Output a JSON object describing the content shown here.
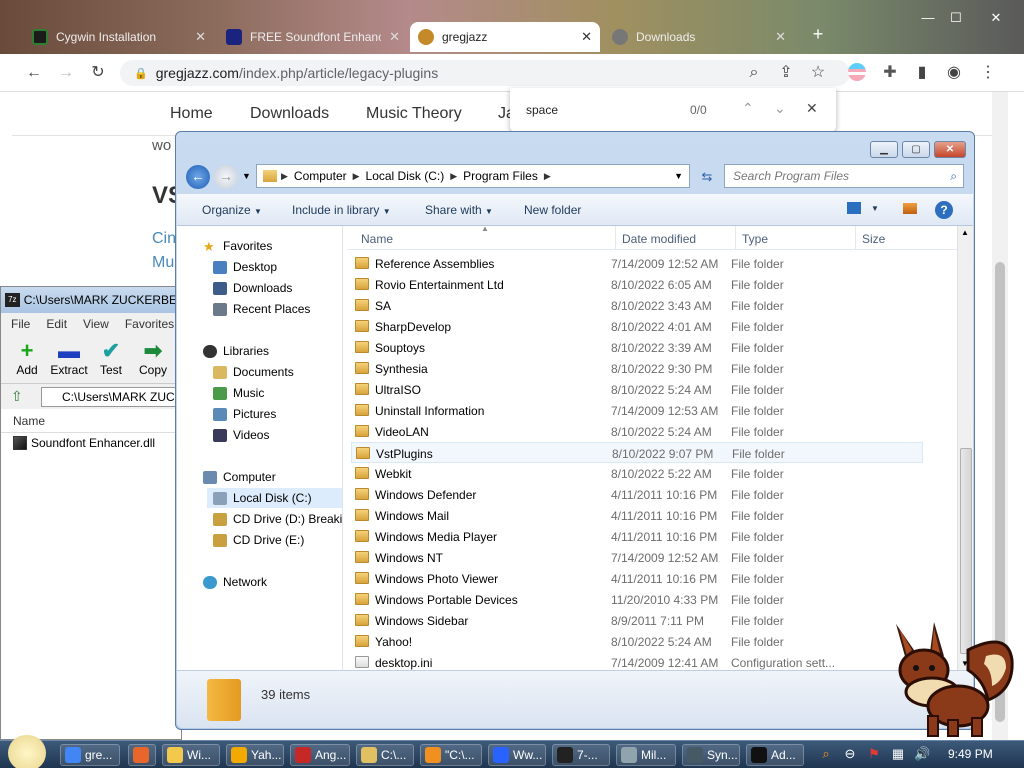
{
  "browser": {
    "tabs": [
      {
        "label": "Cygwin Installation",
        "color": "#2e7d32"
      },
      {
        "label": "FREE Soundfont Enhancer",
        "color": "#1a237e"
      },
      {
        "label": "gregjazz",
        "color": "#c48a2a"
      },
      {
        "label": "Downloads",
        "color": "#777777"
      }
    ],
    "url_host": "gregjazz.com",
    "url_path": "/index.php/article/legacy-plugins",
    "site_nav": [
      "Home",
      "Downloads",
      "Music Theory",
      "Ja"
    ],
    "site_fragments": [
      "wo",
      "VS",
      "Cin",
      "Mu"
    ],
    "find": {
      "query": "space",
      "count": "0/0"
    }
  },
  "sevenzip": {
    "title": "C:\\Users\\MARK ZUCKERBERG",
    "logo": "7z",
    "menu": [
      "File",
      "Edit",
      "View",
      "Favorites"
    ],
    "tools": [
      {
        "label": "Add",
        "glyph": "+",
        "color": "#1aa51a"
      },
      {
        "label": "Extract",
        "glyph": "▬",
        "color": "#1e3fbf"
      },
      {
        "label": "Test",
        "glyph": "✔",
        "color": "#1fa0a0"
      },
      {
        "label": "Copy",
        "glyph": "➡",
        "color": "#1c8a3a"
      }
    ],
    "path": "C:\\Users\\MARK ZUCK",
    "column": "Name",
    "files": [
      "Soundfont Enhancer.dll"
    ]
  },
  "explorer": {
    "breadcrumb": [
      "Computer",
      "Local Disk (C:)",
      "Program Files"
    ],
    "search_placeholder": "Search Program Files",
    "commands": [
      "Organize",
      "Include in library",
      "Share with",
      "New folder"
    ],
    "nav": {
      "favorites_label": "Favorites",
      "favorites": [
        "Desktop",
        "Downloads",
        "Recent Places"
      ],
      "libraries_label": "Libraries",
      "libraries": [
        "Documents",
        "Music",
        "Pictures",
        "Videos"
      ],
      "computer_label": "Computer",
      "drives": [
        "Local Disk (C:)",
        "CD Drive (D:) Breakin",
        "CD Drive (E:)"
      ],
      "network_label": "Network"
    },
    "columns": [
      "Name",
      "Date modified",
      "Type",
      "Size"
    ],
    "files": [
      {
        "name": "Reference Assemblies",
        "date": "7/14/2009 12:52 AM",
        "type": "File folder"
      },
      {
        "name": "Rovio Entertainment Ltd",
        "date": "8/10/2022 6:05 AM",
        "type": "File folder"
      },
      {
        "name": "SA",
        "date": "8/10/2022 3:43 AM",
        "type": "File folder"
      },
      {
        "name": "SharpDevelop",
        "date": "8/10/2022 4:01 AM",
        "type": "File folder"
      },
      {
        "name": "Souptoys",
        "date": "8/10/2022 3:39 AM",
        "type": "File folder"
      },
      {
        "name": "Synthesia",
        "date": "8/10/2022 9:30 PM",
        "type": "File folder"
      },
      {
        "name": "UltraISO",
        "date": "8/10/2022 5:24 AM",
        "type": "File folder"
      },
      {
        "name": "Uninstall Information",
        "date": "7/14/2009 12:53 AM",
        "type": "File folder"
      },
      {
        "name": "VideoLAN",
        "date": "8/10/2022 5:24 AM",
        "type": "File folder"
      },
      {
        "name": "VstPlugins",
        "date": "8/10/2022 9:07 PM",
        "type": "File folder"
      },
      {
        "name": "Webkit",
        "date": "8/10/2022 5:22 AM",
        "type": "File folder"
      },
      {
        "name": "Windows Defender",
        "date": "4/11/2011 10:16 PM",
        "type": "File folder"
      },
      {
        "name": "Windows Mail",
        "date": "4/11/2011 10:16 PM",
        "type": "File folder"
      },
      {
        "name": "Windows Media Player",
        "date": "4/11/2011 10:16 PM",
        "type": "File folder"
      },
      {
        "name": "Windows NT",
        "date": "7/14/2009 12:52 AM",
        "type": "File folder"
      },
      {
        "name": "Windows Photo Viewer",
        "date": "4/11/2011 10:16 PM",
        "type": "File folder"
      },
      {
        "name": "Windows Portable Devices",
        "date": "11/20/2010 4:33 PM",
        "type": "File folder"
      },
      {
        "name": "Windows Sidebar",
        "date": "8/9/2011 7:11 PM",
        "type": "File folder"
      },
      {
        "name": "Yahoo!",
        "date": "8/10/2022 5:24 AM",
        "type": "File folder"
      },
      {
        "name": "desktop.ini",
        "date": "7/14/2009 12:41 AM",
        "type": "Configuration sett..."
      }
    ],
    "item_count": "39 items"
  },
  "taskbar": {
    "items": [
      {
        "label": "gre...",
        "color": "#4285f4"
      },
      {
        "label": "",
        "color": "#e8662a"
      },
      {
        "label": "Wi...",
        "color": "#f2c94c"
      },
      {
        "label": "Yah...",
        "color": "#f2a900"
      },
      {
        "label": "Ang...",
        "color": "#c62828"
      },
      {
        "label": "C:\\...",
        "color": "#e0c060"
      },
      {
        "label": "\"C:\\...",
        "color": "#f09020"
      },
      {
        "label": "Ww...",
        "color": "#2962ff"
      },
      {
        "label": "7-...",
        "color": "#222222"
      },
      {
        "label": "Mil...",
        "color": "#90a4ae"
      },
      {
        "label": "Syn...",
        "color": "#455a64"
      },
      {
        "label": "Ad...",
        "color": "#111111"
      }
    ],
    "clock": "9:49 PM"
  }
}
